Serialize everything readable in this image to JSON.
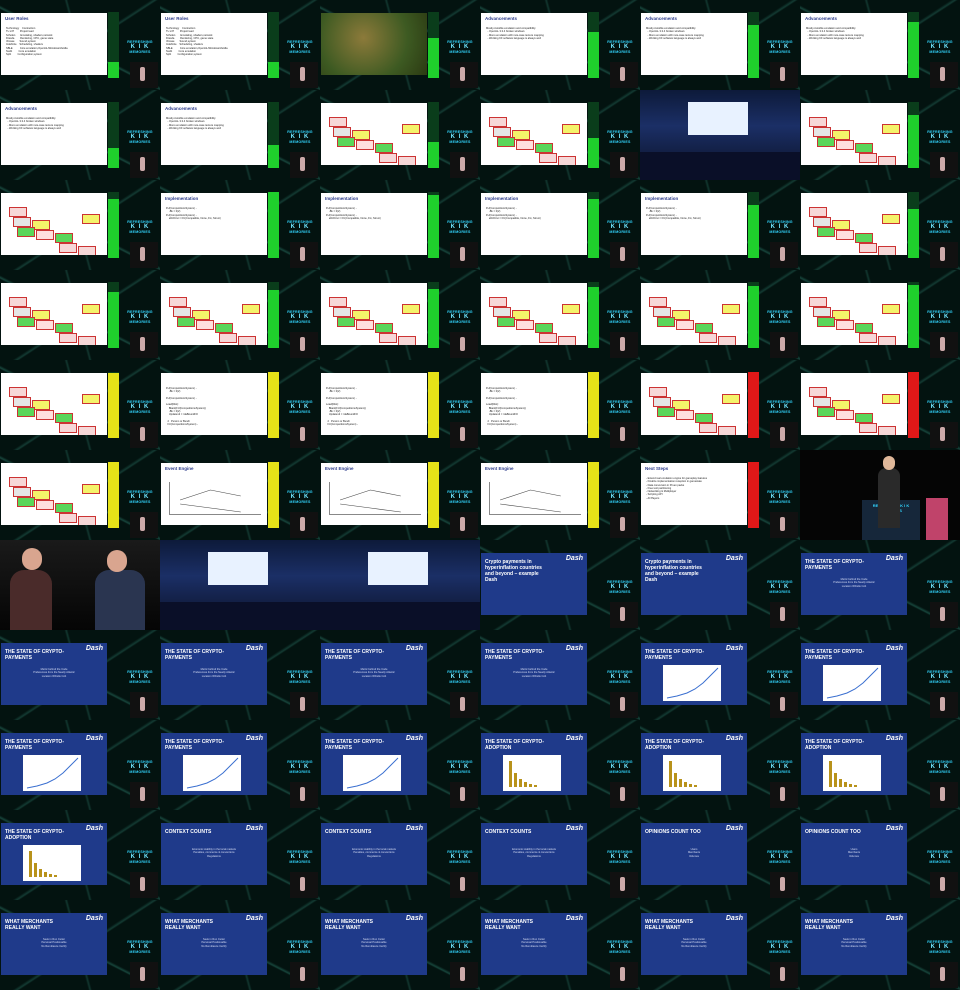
{
  "tiles": [
    {
      "kind": "slide",
      "title": "User Roles",
      "body": "Technology    Contraction\nTL:L37        Project lead\nScholen       Emulating, shaders,network\nDresda        Rendering, CPU, game state\nVitcase       Sound,system\nIndefinite    Scheduling, shaders\nSBLE          Core emulation,OpenGL/Windows/Vanilla\nNudit         Core emulation\nSplit         Configuration,system",
      "bar": 0.25
    },
    {
      "kind": "slide",
      "title": "User Roles",
      "body": "Technology    Contraction\nTL:L37        Project lead\nScholen       Emulating, shaders,network\nDresda        Rendering, CPU, game state\nVitcase       Sound,system\nIndefinite    Scheduling, shaders\nSBLE          Core emulation,OpenGL/Windows/Vanilla\nNudit         Core emulation\nSplit         Configuration,system",
      "bar": 0.25
    },
    {
      "kind": "game",
      "title": "",
      "body": "",
      "bar": 0.6
    },
    {
      "kind": "slide",
      "title": "Advancements",
      "body": "Mostly-invisible emulation and compatibility\n  - OpenGL 3.3.4 broken windows\n  - Mono emulation with rare-case texture mapping\n  - Working KF software language is always well",
      "bar": 0.7
    },
    {
      "kind": "slide",
      "title": "Advancements",
      "body": "Mostly-invisible emulation and compatibility\n  - OpenGL 3.3.4 broken windows\n  - Mono emulation with rare-case texture mapping\n  - Working KF software language is always well",
      "bar": 0.8
    },
    {
      "kind": "slide",
      "title": "Advancements",
      "body": "Mostly-invisible emulation and compatibility\n  - OpenGL 3.3.4 broken windows\n  - Mono emulation with rare-case texture mapping\n  - Working KF software language is always well",
      "bar": 0.85
    },
    {
      "kind": "slide",
      "title": "Advancements",
      "body": "Mostly-invisible emulation and compatibility\n  - OpenGL 3.3.4 broken windows\n  - Mono emulation with rare-case texture mapping\n  - Working KF software language is always well",
      "bar": 0.3
    },
    {
      "kind": "slide",
      "title": "Advancements",
      "body": "Mostly-invisible emulation and compatibility\n  - OpenGL 3.3.4 broken windows\n  - Mono emulation with rare-case texture mapping\n  - Working KF software language is always well",
      "bar": 0.35
    },
    {
      "kind": "diagram",
      "title": "",
      "body": "",
      "bar": 0.4
    },
    {
      "kind": "diagram",
      "title": "",
      "body": "",
      "bar": 0.45
    },
    {
      "kind": "photo",
      "title": "",
      "body": "",
      "bar": 0
    },
    {
      "kind": "diagram",
      "title": "",
      "body": "",
      "bar": 0.8
    },
    {
      "kind": "diagram",
      "title": "",
      "body": "",
      "bar": 0.9
    },
    {
      "kind": "slide",
      "title": "Implementation",
      "body": "FU(CompetitionsSystem) -\n    -Bk = 0(2)\nFU(CompetitionsSystem) -\n    eDirFirst = FU(Compatible, None, Fix, Struct)",
      "bar": 1.0
    },
    {
      "kind": "slide",
      "title": "Implementation",
      "body": "FU(CompetitionsSystem) -\n    -Bk = 0(2)\nFU(CompetitionsSystem) -\n    eDirFirst = FU(Compatible, None, Fix, Struct)",
      "bar": 0.95
    },
    {
      "kind": "slide",
      "title": "Implementation",
      "body": "FU(CompetitionsSystem) -\n    -Bk = 0(2)\nFU(CompetitionsSystem) -\n    eDirFirst = FU(Compatible, None, Fix, Struct)",
      "bar": 0.9
    },
    {
      "kind": "slide",
      "title": "Implementation",
      "body": "FU(CompetitionsSystem) -\n    -Bk = 0(2)\nFU(CompetitionsSystem) -\n    eDirFirst = FU(Compatible, None, Fix, Struct)",
      "bar": 0.8
    },
    {
      "kind": "diagram",
      "title": "",
      "body": "",
      "bar": 0.75
    },
    {
      "kind": "diagram",
      "title": "",
      "body": "",
      "bar": 0.85
    },
    {
      "kind": "diagram",
      "title": "",
      "body": "",
      "bar": 0.88
    },
    {
      "kind": "diagram",
      "title": "",
      "body": "",
      "bar": 0.9
    },
    {
      "kind": "diagram",
      "title": "",
      "body": "",
      "bar": 0.92
    },
    {
      "kind": "diagram",
      "title": "",
      "body": "",
      "bar": 0.94
    },
    {
      "kind": "diagram",
      "title": "",
      "body": "",
      "bar": 0.96
    },
    {
      "kind": "diagram",
      "title": "",
      "body": "",
      "bar": 0.98
    },
    {
      "kind": "slide",
      "title": "",
      "body": "FU(CompetitionsSystem) -\n    -Bk = 0(2)\n\nFU(CompetitionsSystem) -\n\nLoad(Dist):\n    Blank(FU(CompetitionsSystem))\n    -Bk = 0(2)\n    Updatend = rdaBoundFO\n\n  2   Pureim or Bundi\n  FU(CompetitionsSystem) -",
      "bar": 1.0
    },
    {
      "kind": "slide",
      "title": "",
      "body": "FU(CompetitionsSystem) -\n    -Bk = 0(2)\n\nFU(CompetitionsSystem) -\n\nLoad(Dist):\n    Blank(FU(CompetitionsSystem))\n    -Bk = 0(2)\n    Updatend = rdaBoundFO\n\n  2   Pureim or Bundi\n  FU(CompetitionsSystem) -",
      "bar": 1.0
    },
    {
      "kind": "slide",
      "title": "",
      "body": "FU(CompetitionsSystem) -\n    -Bk = 0(2)\n\nFU(CompetitionsSystem) -\n\nLoad(Dist):\n    Blank(FU(CompetitionsSystem))\n    -Bk = 0(2)\n    Updatend = rdaBoundFO\n\n  2   Pureim or Bundi\n  FU(CompetitionsSystem) -",
      "bar": 1.0
    },
    {
      "kind": "diagram",
      "title": "",
      "body": "",
      "bar": 1.0
    },
    {
      "kind": "diagram",
      "title": "",
      "body": "",
      "bar": 1.0
    },
    {
      "kind": "diagram",
      "title": "",
      "body": "",
      "bar": 1.0
    },
    {
      "kind": "chart",
      "title": "Event Engine",
      "body": "",
      "bar": 1.0
    },
    {
      "kind": "chart",
      "title": "Event Engine",
      "body": "",
      "bar": 1.0
    },
    {
      "kind": "chart",
      "title": "Event Engine",
      "body": "",
      "bar": 1.0
    },
    {
      "kind": "slide",
      "title": "Next Steps",
      "body": "- Extend real emulation engine for gameplay features\n- Finalize implementation reception in gamestate\n- Data conversion in Pruen packs\n- Free tool partitioning\n- Networking & Multiplayer\n- Scripting API\n- AI Players",
      "bar": 1.0
    },
    {
      "kind": "speaker",
      "title": "",
      "body": "",
      "bar": 0
    },
    {
      "kind": "cam",
      "title": "",
      "body": "",
      "bar": 0
    },
    {
      "kind": "photo",
      "title": "",
      "body": "",
      "bar": 0
    },
    {
      "kind": "photo",
      "title": "",
      "body": "",
      "bar": 0
    },
    {
      "kind": "dash",
      "title": "Crypto payments in hyperinflation countries and beyond – example Dash",
      "body": "",
      "bar": 0
    },
    {
      "kind": "dash",
      "title": "Crypto payments in hyperinflation countries and beyond – example Dash",
      "body": "",
      "bar": 0
    },
    {
      "kind": "dash",
      "title": "THE STATE OF CRYPTO-PAYMENTS",
      "body": "Metric behind the Code\nPreferences from the Nearly Atlantic\nLocation Whistle Cob",
      "bar": 0
    },
    {
      "kind": "dash",
      "title": "THE STATE OF CRYPTO-PAYMENTS",
      "body": "Metric behind the Code\nPreferences from the Nearly Atlantic\nLocation Whistle Cob",
      "bar": 0
    },
    {
      "kind": "dash",
      "title": "THE STATE OF CRYPTO-PAYMENTS",
      "body": "Metric behind the Code\nPreferences from the Nearly Atlantic\nLocation Whistle Cob",
      "bar": 0
    },
    {
      "kind": "dash",
      "title": "THE STATE OF CRYPTO-PAYMENTS",
      "body": "Metric behind the Code\nPreferences from the Nearly Atlantic\nLocation Whistle Cob",
      "bar": 0
    },
    {
      "kind": "dash",
      "title": "THE STATE OF CRYPTO-PAYMENTS",
      "body": "Metric behind the Code\nPreferences from the Nearly Atlantic\nLocation Whistle Cob",
      "bar": 0
    },
    {
      "kind": "dashchart",
      "title": "THE STATE OF CRYPTO-PAYMENTS",
      "body": "",
      "bar": 0
    },
    {
      "kind": "dashchart",
      "title": "THE STATE OF CRYPTO-PAYMENTS",
      "body": "",
      "bar": 0
    },
    {
      "kind": "dashchart",
      "title": "THE STATE OF CRYPTO-PAYMENTS",
      "body": "",
      "bar": 0
    },
    {
      "kind": "dashchart",
      "title": "THE STATE OF CRYPTO-PAYMENTS",
      "body": "",
      "bar": 0
    },
    {
      "kind": "dashchart",
      "title": "THE STATE OF CRYPTO-PAYMENTS",
      "body": "",
      "bar": 0
    },
    {
      "kind": "dashbar",
      "title": "THE STATE OF CRYPTO-ADOPTION",
      "body": "",
      "bar": 0
    },
    {
      "kind": "dashbar",
      "title": "THE STATE OF CRYPTO-ADOPTION",
      "body": "",
      "bar": 0
    },
    {
      "kind": "dashbar",
      "title": "THE STATE OF CRYPTO-ADOPTION",
      "body": "",
      "bar": 0
    },
    {
      "kind": "dashbar",
      "title": "THE STATE OF CRYPTO-ADOPTION",
      "body": "",
      "bar": 0
    },
    {
      "kind": "dash",
      "title": "CONTEXT COUNTS",
      "body": "Economic stability in the local markets\nPenalties, commerce & conventions\nRegulations",
      "bar": 0
    },
    {
      "kind": "dash",
      "title": "CONTEXT COUNTS",
      "body": "Economic stability in the local markets\nPenalties, commerce & conventions\nRegulations",
      "bar": 0
    },
    {
      "kind": "dash",
      "title": "CONTEXT COUNTS",
      "body": "Economic stability in the local markets\nPenalties, commerce & conventions\nRegulations",
      "bar": 0
    },
    {
      "kind": "dash",
      "title": "OPINIONS COUNT TOO",
      "body": "Users\nMerchants\nVolumes",
      "bar": 0
    },
    {
      "kind": "dash",
      "title": "OPINIONS COUNT TOO",
      "body": "Users\nMerchants\nVolumes",
      "bar": 0
    },
    {
      "kind": "dash",
      "title": "WHAT MERCHANTS REALLY WANT",
      "body": "Seek in Run Cutter\nPersonal Positionable\nNo Remittance Certify",
      "bar": 0
    },
    {
      "kind": "dash",
      "title": "WHAT MERCHANTS REALLY WANT",
      "body": "Seek in Run Cutter\nPersonal Positionable\nNo Remittance Certify",
      "bar": 0
    },
    {
      "kind": "dash",
      "title": "WHAT MERCHANTS REALLY WANT",
      "body": "Seek in Run Cutter\nPersonal Positionable\nNo Remittance Certify",
      "bar": 0
    },
    {
      "kind": "dash",
      "title": "WHAT MERCHANTS REALLY WANT",
      "body": "Seek in Run Cutter\nPersonal Positionable\nNo Remittance Certify",
      "bar": 0
    },
    {
      "kind": "dash",
      "title": "WHAT MERCHANTS REALLY WANT",
      "body": "Seek in Run Cutter\nPersonal Positionable\nNo Remittance Certify",
      "bar": 0
    },
    {
      "kind": "dash",
      "title": "WHAT MERCHANTS REALLY WANT",
      "body": "Seek in Run Cutter\nPersonal Positionable\nNo Remittance Certify",
      "bar": 0
    }
  ],
  "logo": {
    "top": "REFRESHING",
    "mid": "K I K",
    "bottom": "MEMORIES"
  },
  "dash_logo": "Dash",
  "colors": {
    "bar_green": "#1fcf2c",
    "bar_yellow": "#e6e218",
    "bar_red": "#e01818",
    "slide_blue": "#1f3a8a"
  }
}
